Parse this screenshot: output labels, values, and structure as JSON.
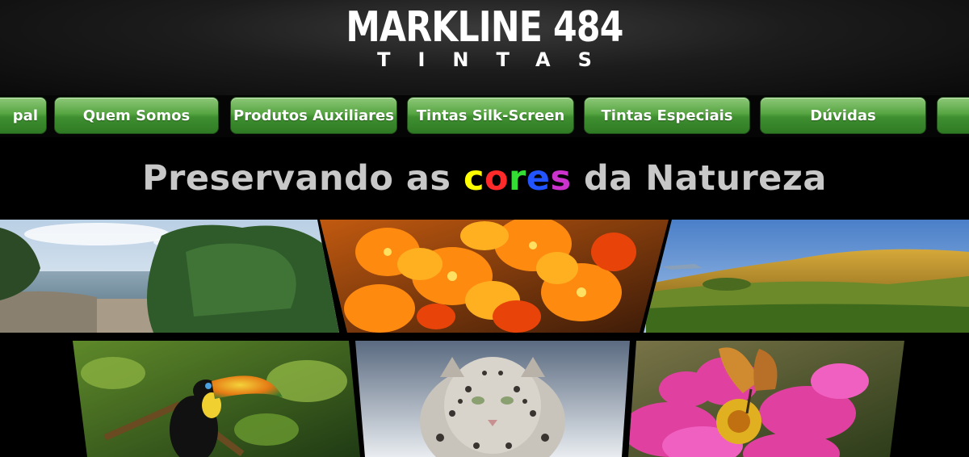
{
  "header": {
    "brand": "MARKLINE 484",
    "subtitle": "TINTAS"
  },
  "nav": {
    "items": [
      {
        "label": "pal"
      },
      {
        "label": "Quem Somos"
      },
      {
        "label": "Produtos Auxiliares"
      },
      {
        "label": "Tintas Silk-Screen"
      },
      {
        "label": "Tintas Especiais"
      },
      {
        "label": "Dúvidas"
      },
      {
        "label": ""
      }
    ]
  },
  "tagline": {
    "before": "Preservando as ",
    "highlight_letters": [
      {
        "char": "c",
        "color": "#ffff00"
      },
      {
        "char": "o",
        "color": "#ff2a2a"
      },
      {
        "char": "r",
        "color": "#33dd33"
      },
      {
        "char": "e",
        "color": "#2255ff"
      },
      {
        "char": "s",
        "color": "#cc33cc"
      }
    ],
    "after": " da Natureza"
  },
  "gallery": {
    "photos": [
      "coastal-trees",
      "orange-flowers",
      "golden-dunes",
      "toucan",
      "snow-leopard",
      "pink-flower-butterfly"
    ]
  },
  "colors": {
    "nav_green": "#4f9e3c",
    "tagline_gray": "#c8c8c8",
    "background": "#000000"
  }
}
